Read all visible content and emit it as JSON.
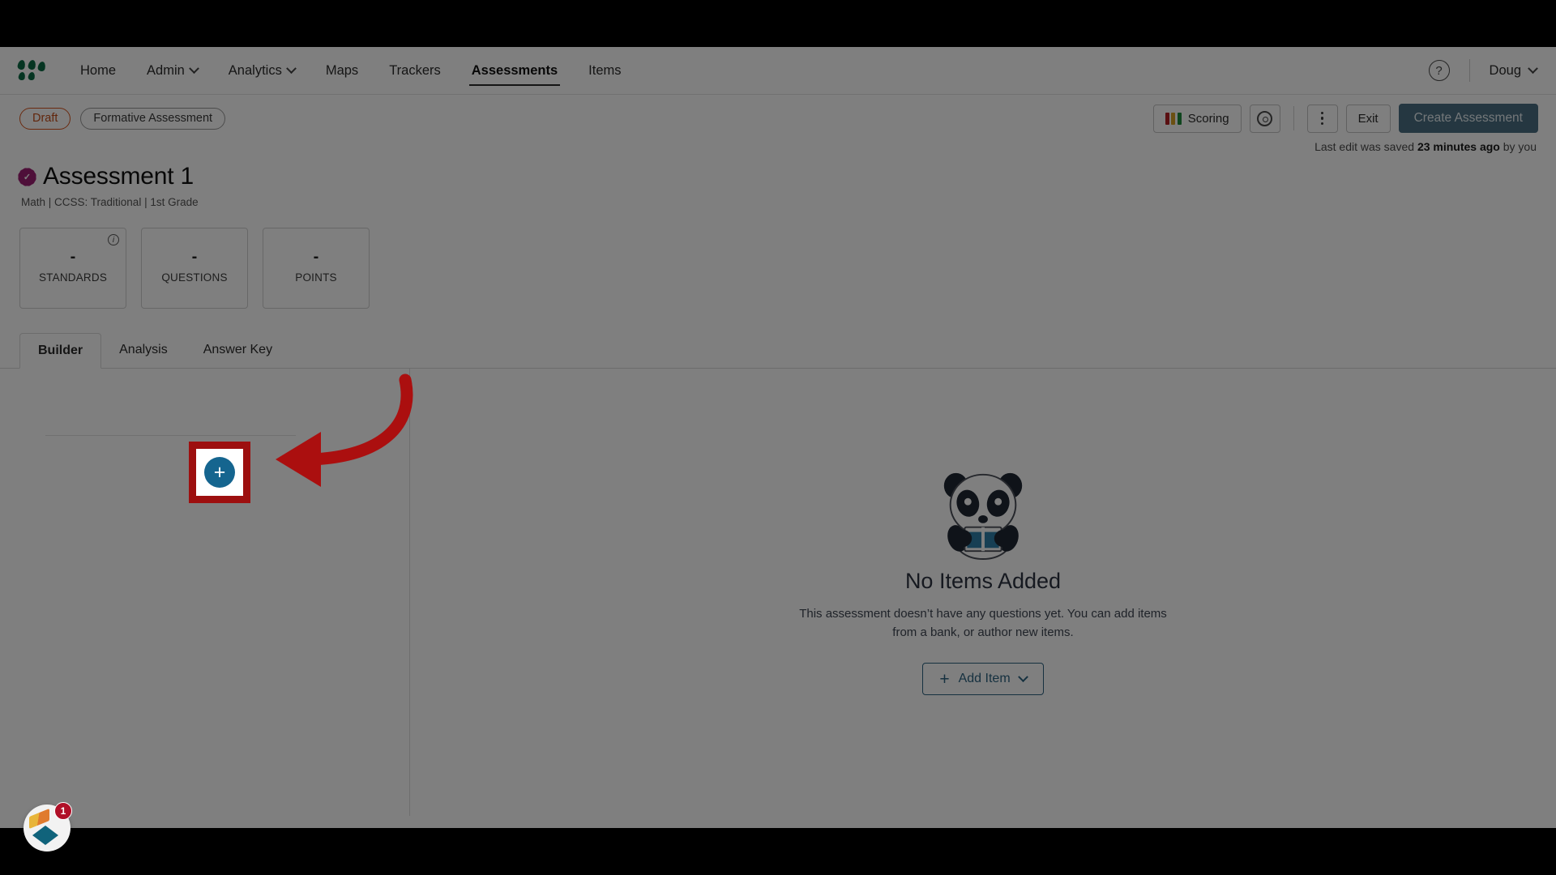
{
  "nav": {
    "logo_name": "mastery-logo",
    "items": [
      {
        "label": "Home",
        "has_caret": false,
        "active": false
      },
      {
        "label": "Admin",
        "has_caret": true,
        "active": false
      },
      {
        "label": "Analytics",
        "has_caret": true,
        "active": false
      },
      {
        "label": "Maps",
        "has_caret": false,
        "active": false
      },
      {
        "label": "Trackers",
        "has_caret": false,
        "active": false
      },
      {
        "label": "Assessments",
        "has_caret": false,
        "active": true
      },
      {
        "label": "Items",
        "has_caret": false,
        "active": false
      }
    ],
    "help_glyph": "?",
    "user_label": "Doug"
  },
  "actionbar": {
    "status_pill": "Draft",
    "type_pill": "Formative Assessment",
    "scoring_label": "Scoring",
    "scoring_colors": [
      "#b52025",
      "#d6a024",
      "#1f8a3c"
    ],
    "settings_name": "gear-icon",
    "more_name": "kebab-menu-icon",
    "exit_label": "Exit",
    "create_label": "Create Assessment",
    "create_color": "#4a6f82"
  },
  "saved": {
    "prefix": "Last edit was saved ",
    "emphasis": "23 minutes ago",
    "suffix": " by you"
  },
  "title": {
    "badge_color": "#9c1f72",
    "text": "Assessment 1",
    "subtitle": "Math  |  CCSS: Traditional  |  1st Grade"
  },
  "stats": [
    {
      "value": "-",
      "label": "STANDARDS",
      "has_info": true
    },
    {
      "value": "-",
      "label": "QUESTIONS",
      "has_info": false
    },
    {
      "value": "-",
      "label": "POINTS",
      "has_info": false
    }
  ],
  "tabs": [
    {
      "label": "Builder",
      "active": true
    },
    {
      "label": "Analysis",
      "active": false
    },
    {
      "label": "Answer Key",
      "active": false
    }
  ],
  "builder": {
    "add_section_glyph": "+",
    "add_section_color": "#15658f",
    "highlight_color": "#9d0f0f",
    "annotation_arrow_color": "#ab0f0f"
  },
  "empty_state": {
    "illustration": "panda-with-book-icon",
    "title": "No Items Added",
    "description": "This assessment doesn’t have any questions yet. You can add items from a bank, or author new items.",
    "button_label": "Add Item",
    "button_plus": "+",
    "button_color": "#2d6280"
  },
  "pendo": {
    "name": "pendo-resource-center",
    "badge_count": "1",
    "badge_color": "#b01028"
  }
}
